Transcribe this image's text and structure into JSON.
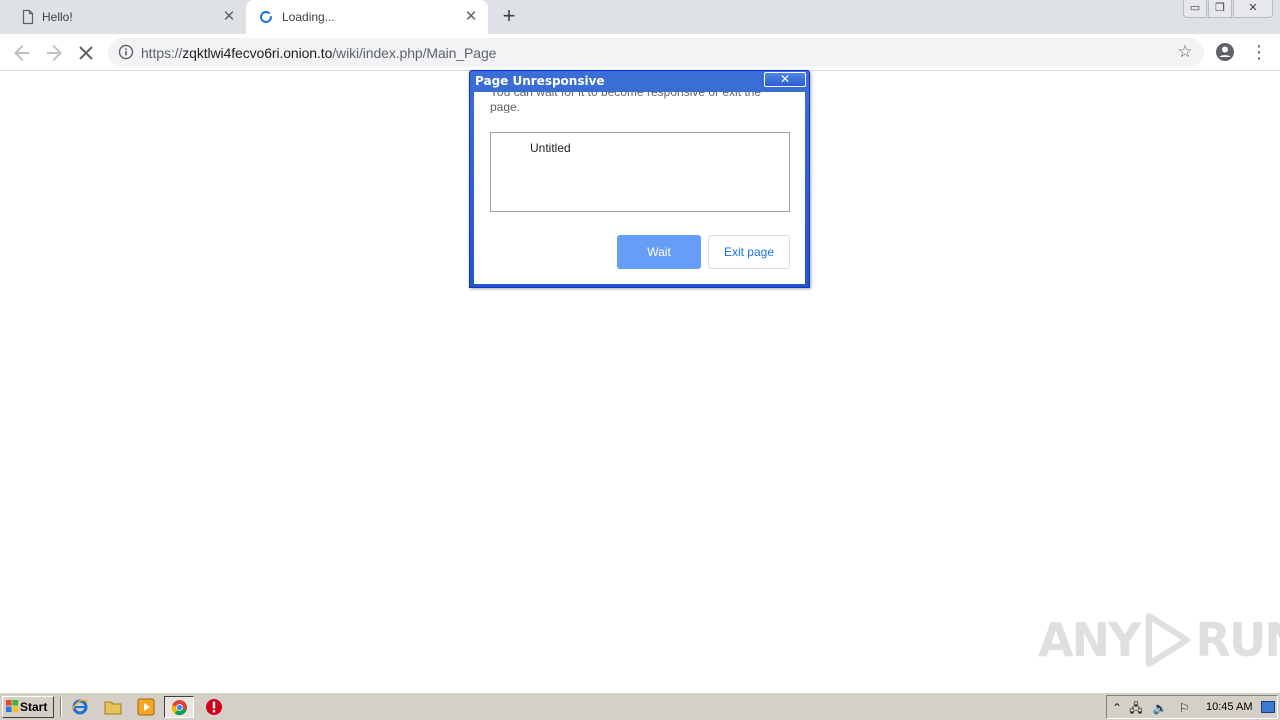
{
  "browser": {
    "tabs": [
      {
        "title": "Hello!",
        "icon": "page-icon",
        "active": false
      },
      {
        "title": "Loading...",
        "icon": "loading-spinner-icon",
        "active": true
      }
    ],
    "address": {
      "scheme": "https://",
      "host": "zqktlwi4fecvo6ri.onion.to",
      "path": "/wiki/index.php/Main_Page"
    }
  },
  "dialog": {
    "title": "Page Unresponsive",
    "close_label": "✕",
    "message": "You can wait for it to become responsive or exit the page.",
    "list_items": [
      "Untitled"
    ],
    "wait_label": "Wait",
    "exit_label": "Exit page"
  },
  "watermark": {
    "left": "ANY",
    "right": "RUN"
  },
  "taskbar": {
    "start_label": "Start",
    "clock": "10:45 AM"
  },
  "colors": {
    "accent": "#669df6",
    "link": "#1a73e8",
    "xp_title": "#2456c6"
  }
}
